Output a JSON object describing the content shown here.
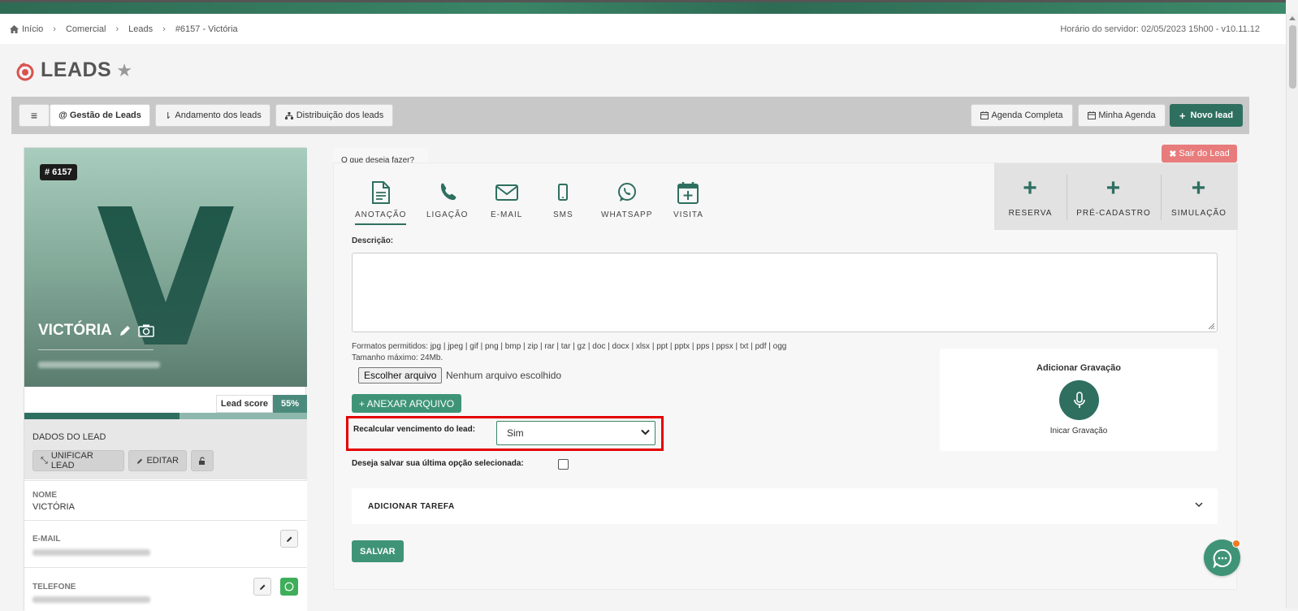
{
  "breadcrumb": {
    "items": [
      "Início",
      "Comercial",
      "Leads",
      "#6157 - Victória"
    ]
  },
  "server_time": "Horário do servidor: 02/05/2023 15h00 - v10.11.12",
  "page": {
    "title": "LEADS"
  },
  "toolbar": {
    "menu_icon": "≡",
    "tabs": [
      {
        "label": "@ Gestão de Leads",
        "active": true
      },
      {
        "label": "Andamento dos leads"
      },
      {
        "label": "Distribuição dos leads"
      }
    ],
    "agenda_completa": "Agenda Completa",
    "minha_agenda": "Minha Agenda",
    "novo_lead": "Novo lead"
  },
  "lead": {
    "id_badge": "# 6157",
    "initial": "V",
    "name": "VICTÓRIA",
    "score_label": "Lead score",
    "score_pct": "55%",
    "score_value": 0.55
  },
  "dados": {
    "title": "DADOS DO LEAD",
    "unificar": "UNIFICAR LEAD",
    "editar": "EDITAR"
  },
  "fields": {
    "nome_label": "NOME",
    "nome_value": "VICTÓRIA",
    "email_label": "E-MAIL",
    "telefone_label": "TELEFONE"
  },
  "form": {
    "tab_title": "O que deseja fazer?",
    "sair": "Sair do Lead",
    "actions": [
      "ANOTAÇÃO",
      "LIGAÇÃO",
      "E-MAIL",
      "SMS",
      "WHATSAPP",
      "VISITA"
    ],
    "extra_actions": [
      "RESERVA",
      "PRÉ-CADASTRO",
      "SIMULAÇÃO"
    ],
    "descricao_label": "Descrição:",
    "formats_line1": "Formatos permitidos: jpg | jpeg | gif | png | bmp | zip | rar | tar | gz | doc | docx | xlsx | ppt | pptx | pps | ppsx | txt | pdf | ogg",
    "formats_line2": "Tamanho máximo: 24Mb.",
    "file_button": "Escolher arquivo",
    "file_name": "Nenhum arquivo escolhido",
    "anexar": "+ ANEXAR ARQUIVO",
    "recalc_label": "Recalcular vencimento do lead:",
    "recalc_value": "Sim",
    "salvar_opcao": "Deseja salvar sua última opção selecionada:",
    "gravacao_title": "Adicionar Gravação",
    "gravacao_label": "Inicar Gravação",
    "tarefa": "ADICIONAR TAREFA",
    "salvar": "SALVAR"
  },
  "colors": {
    "brand": "#2f6f60",
    "accent": "#3f9477",
    "danger": "#e87c7c",
    "highlight": "#e30000"
  }
}
